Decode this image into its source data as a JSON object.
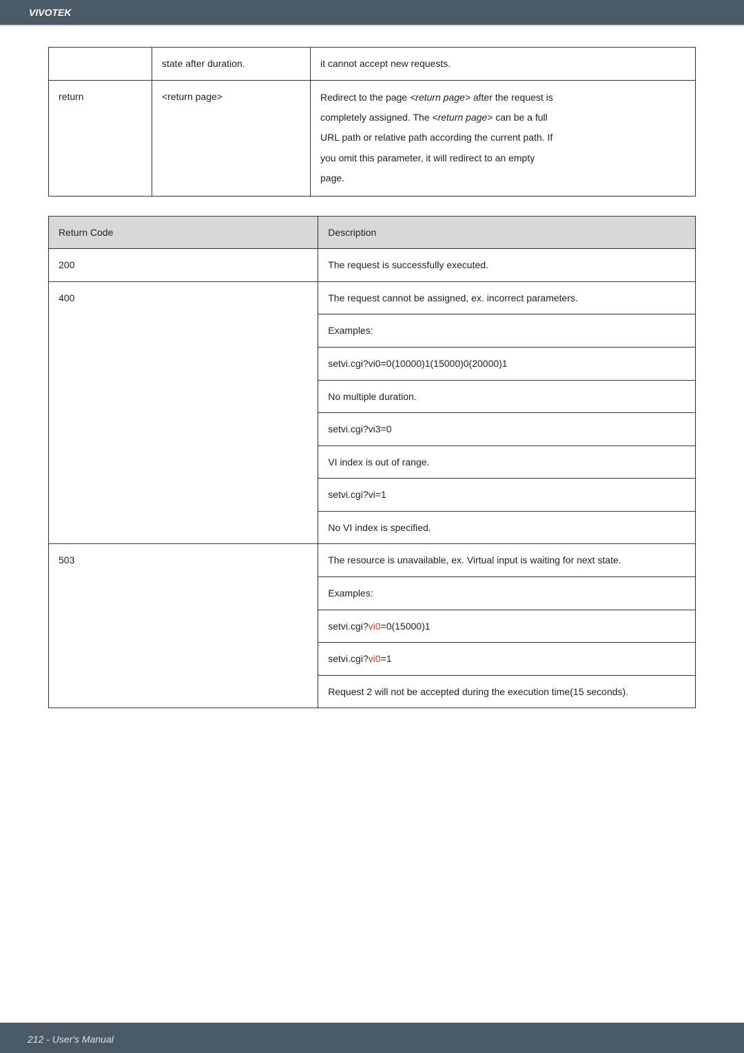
{
  "header": {
    "brand": "VIVOTEK"
  },
  "table1": {
    "rows": [
      {
        "c1": "",
        "c2": "state after duration.",
        "c3": "it cannot accept new requests."
      },
      {
        "c1": "return",
        "c2": "<return page>",
        "c3_lines": [
          {
            "pre": "Redirect to the page ",
            "ital": "<return page>",
            "post": " after the request is"
          },
          {
            "pre": "completely assigned. The ",
            "ital": "<return page>",
            "post": " can be a full"
          },
          {
            "pre": "URL path or relative path according the current path. If",
            "ital": "",
            "post": ""
          },
          {
            "pre": "you omit this parameter, it will redirect to an empty",
            "ital": "",
            "post": ""
          },
          {
            "pre": "page.",
            "ital": "",
            "post": ""
          }
        ]
      }
    ]
  },
  "table2": {
    "head": {
      "c1": "Return Code",
      "c2": "Description"
    },
    "rows": [
      {
        "c1": "200",
        "lines": [
          "The request is successfully executed."
        ]
      },
      {
        "c1": "400",
        "lines": [
          "The request cannot be assigned, ex. incorrect parameters.",
          "Examples:",
          "setvi.cgi?vi0=0(10000)1(15000)0(20000)1",
          "No multiple duration.",
          "setvi.cgi?vi3=0",
          "VI index is out of range.",
          "setvi.cgi?vi=1",
          "No VI index is specified."
        ]
      },
      {
        "c1": "503",
        "mixed_lines": [
          [
            {
              "t": "The resource is unavailable, ex. Virtual input is waiting for next state."
            }
          ],
          [
            {
              "t": "Examples:"
            }
          ],
          [
            {
              "t": "setvi.cgi?"
            },
            {
              "t": "vi0",
              "hl": true
            },
            {
              "t": "=0(15000)1"
            }
          ],
          [
            {
              "t": "setvi.cgi?"
            },
            {
              "t": "vi0",
              "hl": true
            },
            {
              "t": "=1"
            }
          ],
          [
            {
              "t": "Request 2 will not be accepted during the execution time(15 seconds)."
            }
          ]
        ]
      }
    ]
  },
  "footer": {
    "page_label": "212 - User's Manual"
  }
}
